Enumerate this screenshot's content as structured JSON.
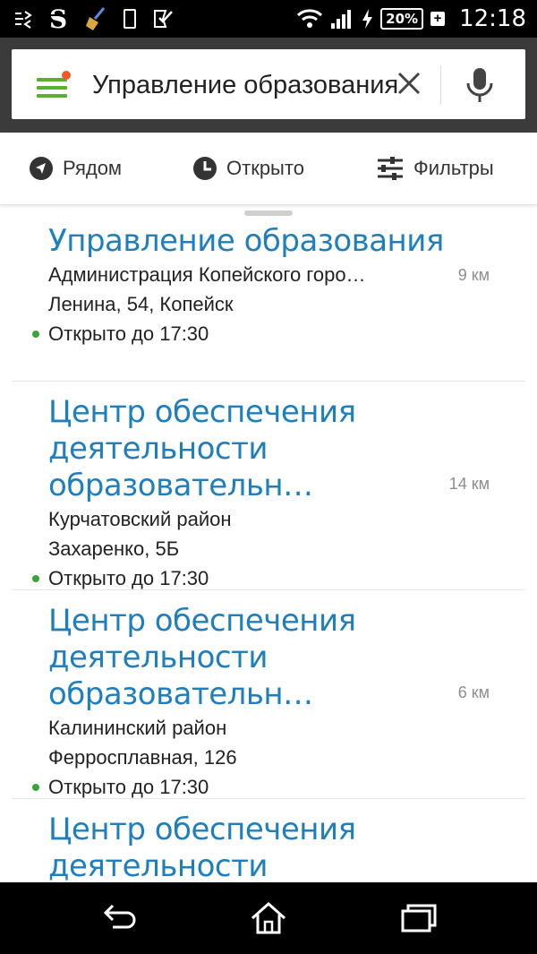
{
  "status_bar": {
    "time": "12:18",
    "battery_percent": "20%",
    "icons": [
      "usb-debug-icon",
      "s-app-icon",
      "broom-icon",
      "phone-icon",
      "check-box-icon",
      "wifi-icon",
      "signal-icon",
      "charging-icon"
    ]
  },
  "search": {
    "query": "Управление образования",
    "menu_badge_color": "#ee5a2a"
  },
  "filters": {
    "near_label": "Рядом",
    "open_label": "Открыто",
    "filters_label": "Фильтры"
  },
  "results": [
    {
      "title": "Управление образования",
      "line1": "Администрация Копейского горо…",
      "line2": "Ленина, 54, Копейск",
      "distance": "9 км",
      "open": "Открыто до 17:30"
    },
    {
      "title": "Центр обеспечения деятельности образовательн…",
      "line1": "Курчатовский район",
      "line2": "Захаренко, 5Б",
      "distance": "14 км",
      "open": "Открыто до 17:30"
    },
    {
      "title": "Центр обеспечения деятельности образовательн…",
      "line1": "Калининский район",
      "line2": "Ферросплавная, 126",
      "distance": "6 км",
      "open": "Открыто до 17:30"
    },
    {
      "title": "Центр обеспечения деятельности образовательн…"
    }
  ],
  "colors": {
    "accent_title": "#1e7fbf",
    "menu_green": "#5bb031",
    "open_dot": "#3aa43a"
  }
}
